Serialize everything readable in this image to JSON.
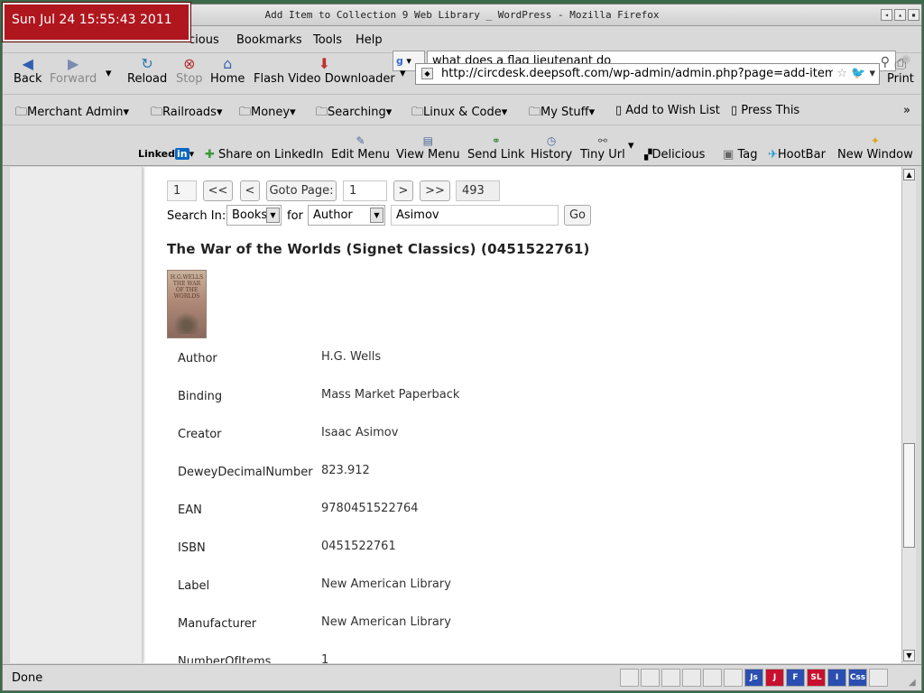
{
  "clock": "Sun Jul 24 15:55:43 2011",
  "window": {
    "title": "Add Item to Collection  9 Web Library  _ WordPress - Mozilla Firefox"
  },
  "menu": {
    "partial": "cious",
    "bookmarks": "Bookmarks",
    "tools": "Tools",
    "help": "Help"
  },
  "search": {
    "value": "what does a flag lieutenant do"
  },
  "nav": {
    "back": "Back",
    "forward": "Forward",
    "reload": "Reload",
    "stop": "Stop",
    "home": "Home",
    "flash": "Flash Video Downloader",
    "print": "Print",
    "url": "http://circdesk.deepsoft.com/wp-admin/admin.php?page=add-item"
  },
  "bookmarks": [
    "Merchant Admin",
    "Railroads",
    "Money",
    "Searching",
    "Linux & Code",
    "My Stuff",
    "Add to Wish List",
    "Press This"
  ],
  "toolbar2": {
    "linkedin": "Linked",
    "linkedin_in": "in",
    "share": "Share on LinkedIn",
    "edit_menu": "Edit Menu",
    "view_menu": "View Menu",
    "send_link": "Send Link",
    "history": "History",
    "tiny_url": "Tiny Url",
    "delicious": "Delicious",
    "tag": "Tag",
    "hootbar": "HootBar",
    "new_window": "New Window"
  },
  "pager": {
    "current": "1",
    "first": "<<",
    "prev": "<",
    "goto_label": "Goto Page:",
    "goto_value": "1",
    "next": ">",
    "last": ">>",
    "total": "493"
  },
  "searchform": {
    "label": "Search In:",
    "in_value": "Books",
    "for_label": "for",
    "field_value": "Author",
    "query": "Asimov",
    "go": "Go"
  },
  "book": {
    "title": "The War of the Worlds (Signet Classics) (0451522761)",
    "cover_text": "H.G.WELLS THE WAR OF THE WORLDS",
    "fields": [
      {
        "label": "Author",
        "value": "H.G. Wells"
      },
      {
        "label": "Binding",
        "value": "Mass Market Paperback"
      },
      {
        "label": "Creator",
        "value": "Isaac Asimov"
      },
      {
        "label": "DeweyDecimalNumber",
        "value": "823.912"
      },
      {
        "label": "EAN",
        "value": "9780451522764"
      },
      {
        "label": "ISBN",
        "value": "0451522761"
      },
      {
        "label": "Label",
        "value": "New American Library"
      },
      {
        "label": "Manufacturer",
        "value": "New American Library"
      },
      {
        "label": "NumberOfItems",
        "value": "1"
      }
    ]
  },
  "status": {
    "text": "Done",
    "icons": [
      "",
      "",
      "",
      "",
      "",
      "",
      "Js",
      "J",
      "F",
      "SL",
      "I",
      "Css",
      ""
    ],
    "icon_colors": [
      "#eaeaea",
      "#eaeaea",
      "#eaeaea",
      "#eaeaea",
      "#eaeaea",
      "#eaeaea",
      "#2a4fb0",
      "#c8102e",
      "#2a4fb0",
      "#c8102e",
      "#2a4fb0",
      "#2a4fb0",
      "#eaeaea"
    ]
  }
}
